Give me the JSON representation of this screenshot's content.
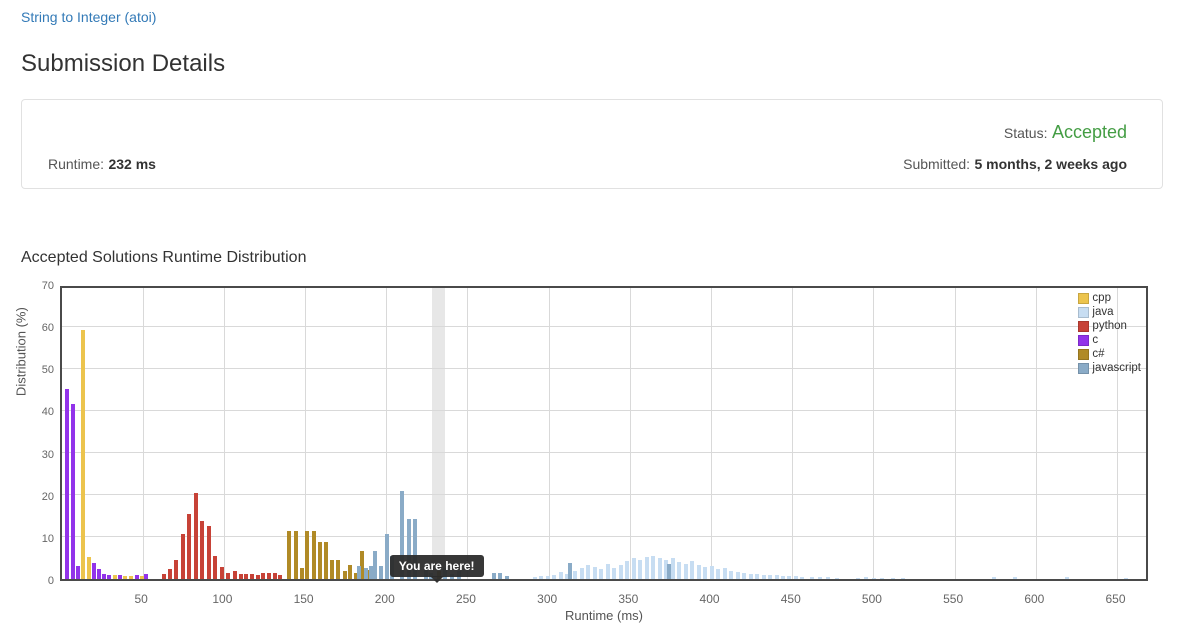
{
  "page": {
    "problem_link": "String to Integer (atoi)",
    "title": "Submission Details"
  },
  "summary": {
    "runtime_label": "Runtime:",
    "runtime_value": "232 ms",
    "status_label": "Status:",
    "status_value": "Accepted",
    "status_color": "#449d44",
    "submitted_label": "Submitted:",
    "submitted_value": "5 months, 2 weeks ago"
  },
  "chart_data": {
    "type": "bar",
    "title": "Accepted Solutions Runtime Distribution",
    "xlabel": "Runtime (ms)",
    "ylabel": "Distribution (%)",
    "xlim": [
      0,
      670
    ],
    "ylim": [
      0,
      70
    ],
    "x_ticks": [
      50,
      100,
      150,
      200,
      250,
      300,
      350,
      400,
      450,
      500,
      550,
      600,
      650
    ],
    "y_ticks": [
      0,
      10,
      20,
      30,
      40,
      50,
      60,
      70
    ],
    "grid": true,
    "legend_position": "top-right-inside",
    "you_are_here": {
      "label": "You are here!",
      "runtime_ms": 232,
      "band_range": [
        228,
        236
      ]
    },
    "series": [
      {
        "name": "cpp",
        "color": "#ecc44d",
        "points": [
          [
            13,
            59.2
          ],
          [
            16.5,
            5.2
          ],
          [
            32.5,
            0.9
          ],
          [
            39,
            0.8
          ],
          [
            42.5,
            0.7
          ],
          [
            49,
            0.6
          ]
        ]
      },
      {
        "name": "java",
        "color": "#c7ddf2",
        "points": [
          [
            291,
            0.5
          ],
          [
            295,
            0.8
          ],
          [
            299,
            0.6
          ],
          [
            303,
            1.0
          ],
          [
            307,
            1.6
          ],
          [
            311,
            1.1
          ],
          [
            316,
            1.9
          ],
          [
            320,
            2.6
          ],
          [
            324,
            3.3
          ],
          [
            328,
            2.9
          ],
          [
            332,
            2.3
          ],
          [
            336,
            3.5
          ],
          [
            340,
            2.6
          ],
          [
            344,
            3.4
          ],
          [
            348,
            4.3
          ],
          [
            352,
            5.0
          ],
          [
            356,
            4.6
          ],
          [
            360,
            5.2
          ],
          [
            364,
            5.5
          ],
          [
            368,
            5.0
          ],
          [
            372,
            4.4
          ],
          [
            376,
            4.9
          ],
          [
            380,
            4.1
          ],
          [
            384,
            3.6
          ],
          [
            388,
            4.2
          ],
          [
            392,
            3.3
          ],
          [
            396,
            2.9
          ],
          [
            400,
            3.1
          ],
          [
            404,
            2.3
          ],
          [
            408,
            2.7
          ],
          [
            412,
            2.0
          ],
          [
            416,
            1.6
          ],
          [
            420,
            1.5
          ],
          [
            424,
            1.3
          ],
          [
            428,
            1.2
          ],
          [
            432,
            1.0
          ],
          [
            436,
            1.0
          ],
          [
            440,
            0.9
          ],
          [
            444,
            0.8
          ],
          [
            448,
            0.7
          ],
          [
            452,
            0.6
          ],
          [
            456,
            0.5
          ],
          [
            462,
            0.4
          ],
          [
            467,
            0.4
          ],
          [
            472,
            0.4
          ],
          [
            477,
            0.3
          ],
          [
            490,
            0.3
          ],
          [
            495,
            0.4
          ],
          [
            500,
            0.3
          ],
          [
            505,
            0.3
          ],
          [
            512,
            0.3
          ],
          [
            518,
            0.3
          ],
          [
            574,
            0.4
          ],
          [
            587,
            0.5
          ],
          [
            619,
            0.4
          ],
          [
            655,
            0.3
          ],
          [
            671,
            0.5
          ]
        ]
      },
      {
        "name": "python",
        "color": "#c74237",
        "points": [
          [
            63,
            1.2
          ],
          [
            66.5,
            2.3
          ],
          [
            70.5,
            4.6
          ],
          [
            74.5,
            10.7
          ],
          [
            78.5,
            15.4
          ],
          [
            82.5,
            20.4
          ],
          [
            86.5,
            13.8
          ],
          [
            90.5,
            12.6
          ],
          [
            94.5,
            5.5
          ],
          [
            98.5,
            2.8
          ],
          [
            102.5,
            1.4
          ],
          [
            106.5,
            1.8
          ],
          [
            110,
            1.2
          ],
          [
            113.5,
            1.1
          ],
          [
            117,
            1.1
          ],
          [
            120.5,
            1.0
          ],
          [
            124,
            1.5
          ],
          [
            127.5,
            1.5
          ],
          [
            131,
            1.5
          ],
          [
            134.5,
            1.0
          ]
        ]
      },
      {
        "name": "c",
        "color": "#9233ea",
        "points": [
          [
            3,
            45.2
          ],
          [
            6.5,
            41.5
          ],
          [
            10,
            3.0
          ],
          [
            19.5,
            3.8
          ],
          [
            22.5,
            2.3
          ],
          [
            26,
            1.3
          ],
          [
            29,
            1.0
          ],
          [
            36,
            0.9
          ],
          [
            46,
            1.0
          ],
          [
            52,
            1.1
          ]
        ]
      },
      {
        "name": "c#",
        "color": "#b08a26",
        "points": [
          [
            140,
            11.3
          ],
          [
            144,
            11.3
          ],
          [
            147.5,
            2.5
          ],
          [
            151,
            11.3
          ],
          [
            155,
            11.3
          ],
          [
            159,
            8.9
          ],
          [
            162.5,
            8.9
          ],
          [
            166.5,
            4.6
          ],
          [
            170,
            4.4
          ],
          [
            174,
            2.0
          ],
          [
            177.5,
            3.3
          ],
          [
            181,
            1.5
          ],
          [
            185,
            6.6
          ],
          [
            189,
            2.2
          ],
          [
            232,
            2.0
          ]
        ]
      },
      {
        "name": "javascript",
        "color": "#8aabc7",
        "points": [
          [
            183,
            3.0
          ],
          [
            187,
            2.6
          ],
          [
            190,
            3.0
          ],
          [
            193,
            6.6
          ],
          [
            196.5,
            3.0
          ],
          [
            200,
            10.6
          ],
          [
            203.5,
            5.5
          ],
          [
            209.5,
            20.8
          ],
          [
            213.5,
            14.2
          ],
          [
            217.5,
            14.2
          ],
          [
            224,
            2.5
          ],
          [
            227.5,
            1.5
          ],
          [
            236,
            2.5
          ],
          [
            240,
            1.2
          ],
          [
            244.5,
            1.8
          ],
          [
            266,
            1.5
          ],
          [
            270,
            1.5
          ],
          [
            274,
            0.8
          ],
          [
            313,
            3.9
          ],
          [
            374,
            3.5
          ]
        ]
      }
    ]
  }
}
